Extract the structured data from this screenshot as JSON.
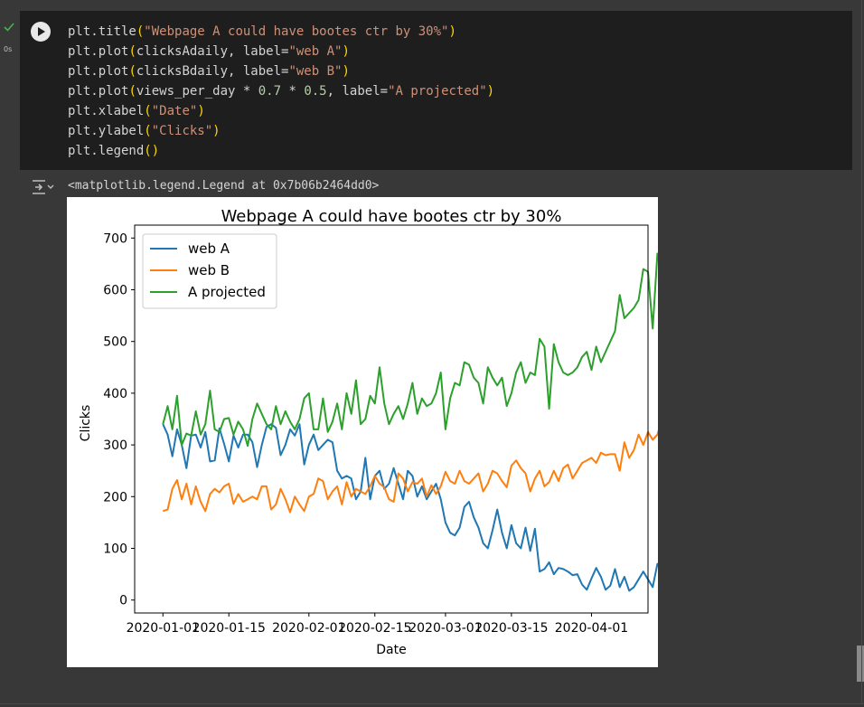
{
  "cell": {
    "exec_time": "0s",
    "code_lines": [
      [
        {
          "t": "plt.title"
        },
        {
          "t": "(",
          "c": "paren"
        },
        {
          "t": "\"Webpage A could have bootes ctr by 30%\"",
          "c": "str"
        },
        {
          "t": ")",
          "c": "paren"
        }
      ],
      [
        {
          "t": "plt.plot"
        },
        {
          "t": "(",
          "c": "paren"
        },
        {
          "t": "clicksAdaily, label="
        },
        {
          "t": "\"web A\"",
          "c": "str"
        },
        {
          "t": ")",
          "c": "paren"
        }
      ],
      [
        {
          "t": "plt.plot"
        },
        {
          "t": "(",
          "c": "paren"
        },
        {
          "t": "clicksBdaily, label="
        },
        {
          "t": "\"web B\"",
          "c": "str"
        },
        {
          "t": ")",
          "c": "paren"
        }
      ],
      [
        {
          "t": "plt.plot"
        },
        {
          "t": "(",
          "c": "paren"
        },
        {
          "t": "views_per_day * "
        },
        {
          "t": "0.7",
          "c": "num"
        },
        {
          "t": " * "
        },
        {
          "t": "0.5",
          "c": "num"
        },
        {
          "t": ", label="
        },
        {
          "t": "\"A projected\"",
          "c": "str"
        },
        {
          "t": ")",
          "c": "paren"
        }
      ],
      [
        {
          "t": "plt.xlabel"
        },
        {
          "t": "(",
          "c": "paren"
        },
        {
          "t": "\"Date\"",
          "c": "str"
        },
        {
          "t": ")",
          "c": "paren"
        }
      ],
      [
        {
          "t": "plt.ylabel"
        },
        {
          "t": "(",
          "c": "paren"
        },
        {
          "t": "\"Clicks\"",
          "c": "str"
        },
        {
          "t": ")",
          "c": "paren"
        }
      ],
      [
        {
          "t": "plt.legend"
        },
        {
          "t": "()",
          "c": "paren"
        }
      ]
    ],
    "output_text": "<matplotlib.legend.Legend at 0x7b06b2464dd0>"
  },
  "icons": {
    "run": "play-icon",
    "status": "check-icon",
    "output": "output-toggle-icon"
  },
  "colors": {
    "web_a": "#1f77b4",
    "web_b": "#ff7f0e",
    "projected": "#2ca02c",
    "cell_bg": "#1e1e1e",
    "page_bg": "#383838"
  },
  "chart_data": {
    "type": "line",
    "title": "Webpage A could have bootes ctr by 30%",
    "xlabel": "Date",
    "ylabel": "Clicks",
    "x_start": "2020-01-01",
    "x_ticks": [
      "2020-01-01",
      "2020-01-15",
      "2020-02-01",
      "2020-02-15",
      "2020-03-01",
      "2020-03-15",
      "2020-04-01"
    ],
    "y_ticks": [
      "0",
      "100",
      "200",
      "300",
      "400",
      "500",
      "600",
      "700"
    ],
    "ylim": [
      -25,
      725
    ],
    "xlim": [
      "2019-12-26",
      "2020-04-13"
    ],
    "legend": "upper left",
    "series": [
      {
        "name": "web A",
        "values": [
          340,
          320,
          278,
          330,
          300,
          255,
          318,
          320,
          295,
          325,
          268,
          270,
          332,
          302,
          268,
          318,
          295,
          320,
          320,
          305,
          257,
          300,
          335,
          340,
          333,
          280,
          300,
          330,
          318,
          340,
          262,
          300,
          320,
          290,
          300,
          310,
          305,
          250,
          235,
          240,
          235,
          195,
          210,
          275,
          195,
          240,
          250,
          215,
          225,
          255,
          225,
          195,
          250,
          240,
          200,
          220,
          195,
          210,
          225,
          195,
          150,
          130,
          125,
          140,
          180,
          190,
          160,
          140,
          110,
          100,
          135,
          175,
          130,
          100,
          145,
          110,
          100,
          140,
          95,
          138,
          55,
          60,
          73,
          50,
          62,
          60,
          55,
          48,
          50,
          30,
          20,
          42,
          62,
          45,
          20,
          28,
          60,
          25,
          45,
          18,
          25,
          40,
          55,
          40,
          25,
          70,
          55,
          48,
          22,
          28,
          25,
          104,
          45
        ]
      },
      {
        "name": "web B",
        "values": [
          172,
          175,
          215,
          232,
          195,
          225,
          185,
          220,
          190,
          172,
          205,
          215,
          208,
          220,
          225,
          186,
          205,
          190,
          195,
          200,
          195,
          220,
          220,
          175,
          185,
          215,
          195,
          170,
          200,
          185,
          172,
          200,
          205,
          235,
          230,
          195,
          210,
          220,
          185,
          228,
          200,
          215,
          210,
          205,
          220,
          240,
          225,
          218,
          195,
          190,
          245,
          235,
          210,
          228,
          225,
          235,
          200,
          222,
          205,
          220,
          248,
          230,
          225,
          250,
          230,
          225,
          235,
          245,
          210,
          225,
          250,
          245,
          230,
          218,
          260,
          270,
          255,
          245,
          210,
          235,
          250,
          220,
          228,
          250,
          230,
          255,
          262,
          235,
          250,
          265,
          270,
          275,
          265,
          285,
          280,
          282,
          282,
          250,
          305,
          275,
          290,
          320,
          300,
          325,
          310,
          320,
          350,
          310,
          340,
          325,
          355,
          375,
          355
        ]
      },
      {
        "name": "A projected",
        "values": [
          340,
          375,
          330,
          395,
          300,
          322,
          318,
          365,
          320,
          340,
          405,
          330,
          325,
          350,
          352,
          320,
          345,
          330,
          298,
          350,
          380,
          360,
          340,
          330,
          375,
          340,
          365,
          345,
          330,
          350,
          390,
          400,
          330,
          330,
          390,
          325,
          345,
          380,
          330,
          400,
          360,
          425,
          340,
          350,
          395,
          380,
          450,
          380,
          340,
          360,
          375,
          350,
          380,
          420,
          360,
          390,
          375,
          380,
          400,
          440,
          330,
          390,
          420,
          415,
          460,
          455,
          430,
          420,
          380,
          450,
          430,
          415,
          430,
          375,
          400,
          440,
          460,
          420,
          440,
          435,
          505,
          490,
          370,
          495,
          460,
          440,
          435,
          440,
          450,
          470,
          480,
          445,
          490,
          460,
          480,
          500,
          520,
          590,
          545,
          555,
          565,
          580,
          640,
          635,
          525,
          670,
          640,
          620,
          680,
          630
        ]
      }
    ]
  }
}
